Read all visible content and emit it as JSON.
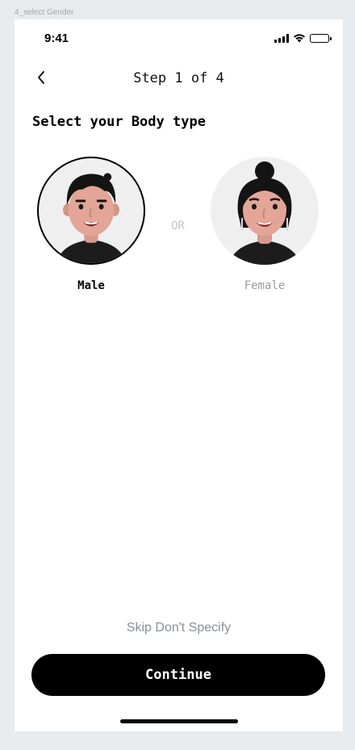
{
  "frame": {
    "label": "4_select Gender"
  },
  "status_bar": {
    "time": "9:41",
    "icons": [
      "signal-icon",
      "wifi-icon",
      "battery-icon"
    ]
  },
  "header": {
    "back_icon": "chevron-left-icon",
    "step_text": "Step 1 of 4"
  },
  "main": {
    "title": "Select your Body type",
    "separator": "OR",
    "options": [
      {
        "label": "Male",
        "selected": true,
        "avatar": "male-avatar"
      },
      {
        "label": "Female",
        "selected": false,
        "avatar": "female-avatar"
      }
    ]
  },
  "footer": {
    "skip_label": "Skip Don't Specify",
    "continue_label": "Continue"
  },
  "colors": {
    "background": "#e8ebee",
    "surface": "#ffffff",
    "primary": "#000000",
    "muted_text": "#9b9b9b",
    "avatar_bg": "#efefef"
  }
}
